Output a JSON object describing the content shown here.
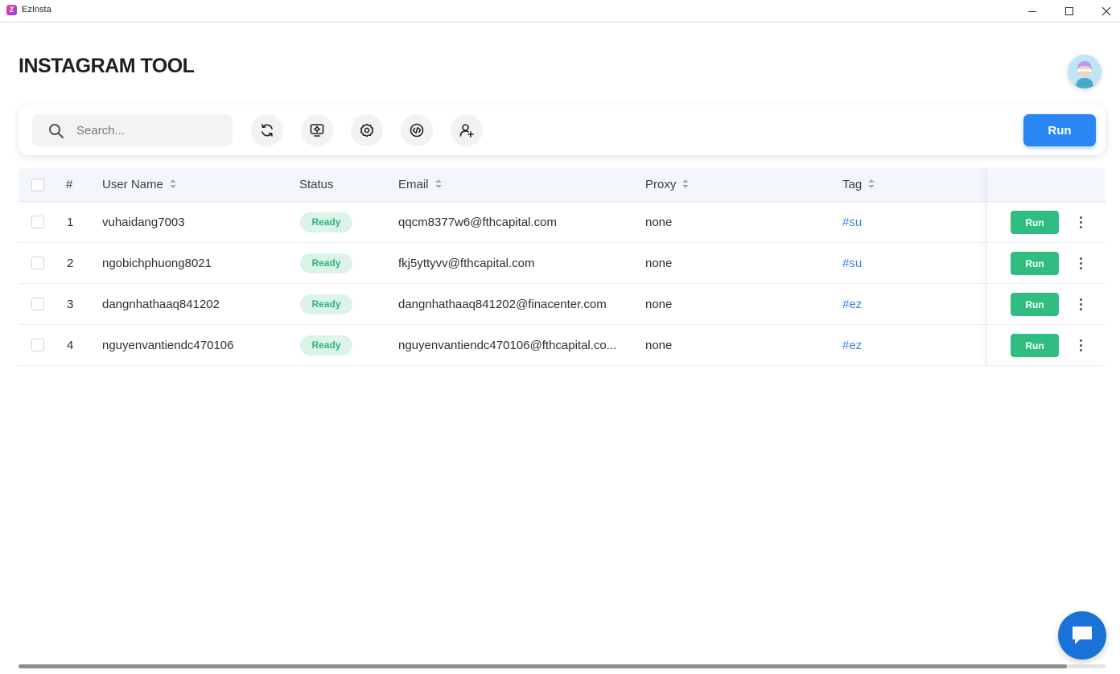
{
  "window": {
    "title": "EzInsta",
    "logo_letter": "Z"
  },
  "header": {
    "title": "INSTAGRAM TOOL"
  },
  "toolbar": {
    "search_placeholder": "Search...",
    "tools": [
      "refresh-icon",
      "screen-settings-icon",
      "settings-icon",
      "code-icon",
      "add-user-icon"
    ],
    "run_label": "Run"
  },
  "table": {
    "columns": {
      "index": "#",
      "username": "User Name",
      "status": "Status",
      "email": "Email",
      "proxy": "Proxy",
      "tag": "Tag"
    },
    "rows": [
      {
        "index": "1",
        "username": "vuhaidang7003",
        "status": "Ready",
        "email": "qqcm8377w6@fthcapital.com",
        "proxy": "none",
        "tag": "#su",
        "run": "Run"
      },
      {
        "index": "2",
        "username": "ngobichphuong8021",
        "status": "Ready",
        "email": "fkj5yttyvv@fthcapital.com",
        "proxy": "none",
        "tag": "#su",
        "run": "Run"
      },
      {
        "index": "3",
        "username": "dangnhathaaq841202",
        "status": "Ready",
        "email": "dangnhathaaq841202@finacenter.com",
        "proxy": "none",
        "tag": "#ez",
        "run": "Run"
      },
      {
        "index": "4",
        "username": "nguyenvantiendc470106",
        "status": "Ready",
        "email": "nguyenvantiendc470106@fthcapital.co...",
        "proxy": "none",
        "tag": "#ez",
        "run": "Run"
      }
    ]
  },
  "colors": {
    "primary": "#2b86f5",
    "success": "#2fbd82",
    "tag": "#3d7fe6",
    "chat": "#1a72d9"
  }
}
